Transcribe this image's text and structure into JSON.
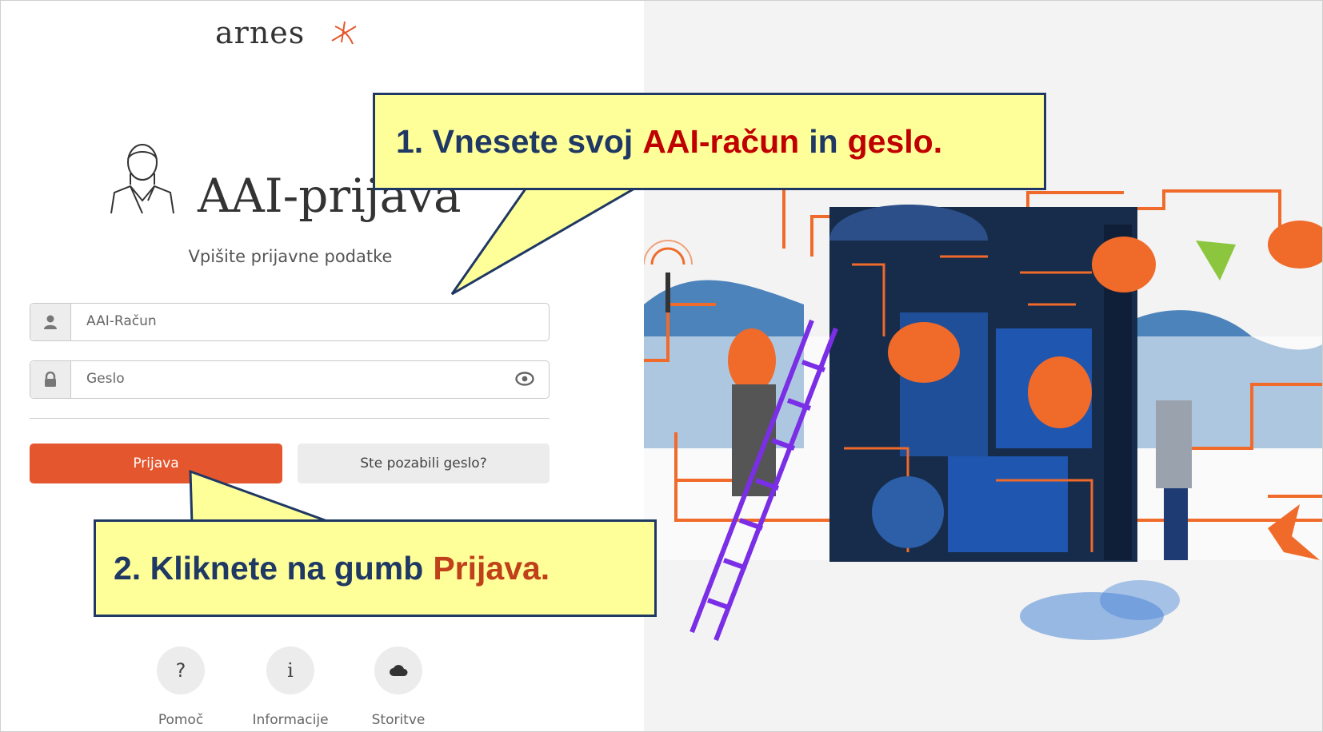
{
  "brand": {
    "logo_text": "arnes"
  },
  "login": {
    "title": "AAI-prijava",
    "subtitle": "Vpišite prijavne podatke",
    "username_placeholder": "AAI-Račun",
    "password_placeholder": "Geslo",
    "submit_label": "Prijava",
    "forgot_label": "Ste pozabili geslo?"
  },
  "footer_links": [
    {
      "label": "Pomoč",
      "icon": "?"
    },
    {
      "label": "Informacije",
      "icon": "i"
    },
    {
      "label": "Storitve",
      "icon": "cloud-icon"
    }
  ],
  "callouts": {
    "first": {
      "prefix": "1. Vnesete svoj",
      "highlight1": "AAI-račun",
      "middle": "in",
      "highlight2": "geslo."
    },
    "second": {
      "prefix": "2. Kliknete na gumb",
      "highlight": "Prijava."
    }
  },
  "colors": {
    "accent": "#e4572e",
    "callout_bg": "#ffff99",
    "callout_border": "#1f3864",
    "callout_highlight": "#c00000"
  }
}
